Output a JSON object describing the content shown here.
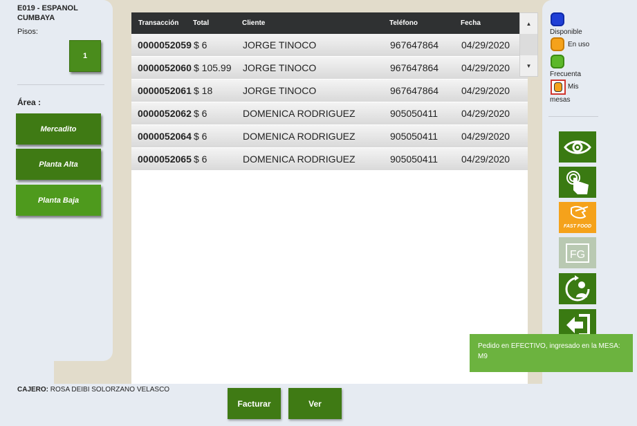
{
  "store": {
    "name_line1": "E019 - ESPANOL",
    "name_line2": "CUMBAYA"
  },
  "floors": {
    "label": "Pisos:",
    "items": [
      "1"
    ]
  },
  "area": {
    "label": "Área :",
    "items": [
      {
        "label": "Mercadito"
      },
      {
        "label": "Planta Alta"
      },
      {
        "label": "Planta Baja"
      }
    ]
  },
  "table": {
    "headers": [
      "Transacción",
      "Total",
      "Cliente",
      "Teléfono",
      "Fecha"
    ],
    "rows": [
      [
        "0000052059",
        "$ 6",
        "JORGE TINOCO",
        "967647864",
        "04/29/2020"
      ],
      [
        "0000052060",
        "$ 105.99",
        "JORGE TINOCO",
        "967647864",
        "04/29/2020"
      ],
      [
        "0000052061",
        "$ 18",
        "JORGE TINOCO",
        "967647864",
        "04/29/2020"
      ],
      [
        "0000052062",
        "$ 6",
        "DOMENICA RODRIGUEZ",
        "905050411",
        "04/29/2020"
      ],
      [
        "0000052064",
        "$ 6",
        "DOMENICA RODRIGUEZ",
        "905050411",
        "04/29/2020"
      ],
      [
        "0000052065",
        "$ 6",
        "DOMENICA RODRIGUEZ",
        "905050411",
        "04/29/2020"
      ]
    ]
  },
  "legend": {
    "disponible": "Disponible",
    "en_uso": "En uso",
    "frecuenta": "Frecuenta",
    "mis": "Mis",
    "mesas": "mesas",
    "colors": {
      "disponible": "#1f3fd6",
      "en_uso": "#f5a21b",
      "frecuenta": "#5cb82a",
      "mis_border": "#d0342c"
    }
  },
  "actions": [
    {
      "icon": "eye-icon"
    },
    {
      "icon": "touch-hand-icon"
    },
    {
      "icon": "fast-food-icon",
      "label": "FAST FOOD"
    },
    {
      "icon": "fg-icon",
      "label": "FG"
    },
    {
      "icon": "refresh-user-icon"
    },
    {
      "icon": "exit-arrow-icon"
    }
  ],
  "toast": {
    "message": "Pedido en EFECTIVO, ingresado en la MESA: M9"
  },
  "footer": {
    "cajero_label": "CAJERO:",
    "cajero_name": "ROSA DEIBI SOLORZANO VELASCO",
    "facturar": "Facturar",
    "ver": "Ver"
  },
  "colors": {
    "primary_green": "#3f7a14",
    "toast_green": "#6cb33f",
    "header_dark": "#2f3132"
  }
}
